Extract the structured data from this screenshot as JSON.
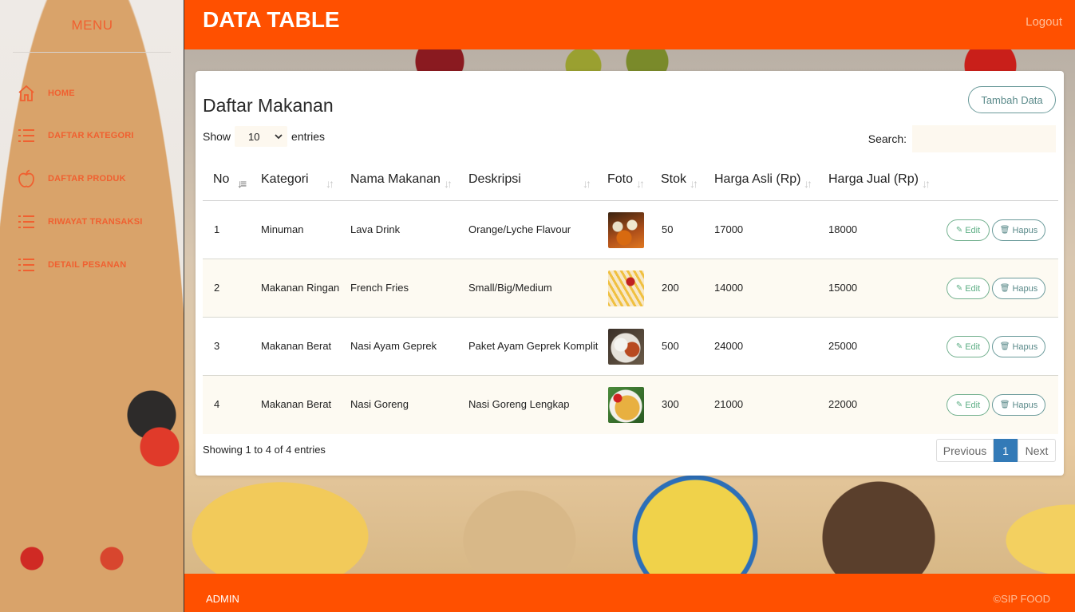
{
  "sidebar": {
    "title": "MENU",
    "items": [
      {
        "label": "HOME",
        "icon": "home-icon"
      },
      {
        "label": "DAFTAR KATEGORI",
        "icon": "list-icon"
      },
      {
        "label": "DAFTAR PRODUK",
        "icon": "apple-icon"
      },
      {
        "label": "RIWAYAT TRANSAKSI",
        "icon": "list-icon"
      },
      {
        "label": "DETAIL PESANAN",
        "icon": "list-icon"
      }
    ]
  },
  "header": {
    "title": "DATA TABLE",
    "logout": "Logout"
  },
  "card": {
    "title": "Daftar Makanan",
    "add_button": "Tambah Data",
    "show_label": "Show",
    "show_value": "10",
    "entries_label": "entries",
    "search_label": "Search:",
    "search_value": ""
  },
  "table": {
    "columns": [
      "No",
      "Kategori",
      "Nama Makanan",
      "Deskripsi",
      "Foto",
      "Stok",
      "Harga Asli (Rp)",
      "Harga Jual (Rp)"
    ],
    "rows": [
      {
        "no": "1",
        "kategori": "Minuman",
        "nama": "Lava Drink",
        "deskripsi": "Orange/Lyche Flavour",
        "stok": "50",
        "harga_asli": "17000",
        "harga_jual": "18000"
      },
      {
        "no": "2",
        "kategori": "Makanan Ringan",
        "nama": "French Fries",
        "deskripsi": "Small/Big/Medium",
        "stok": "200",
        "harga_asli": "14000",
        "harga_jual": "15000"
      },
      {
        "no": "3",
        "kategori": "Makanan Berat",
        "nama": "Nasi Ayam Geprek",
        "deskripsi": "Paket Ayam Geprek Komplit",
        "stok": "500",
        "harga_asli": "24000",
        "harga_jual": "25000"
      },
      {
        "no": "4",
        "kategori": "Makanan Berat",
        "nama": "Nasi Goreng",
        "deskripsi": "Nasi Goreng Lengkap",
        "stok": "300",
        "harga_asli": "21000",
        "harga_jual": "22000"
      }
    ],
    "edit_label": "Edit",
    "delete_label": "Hapus"
  },
  "footer_table": {
    "info": "Showing 1 to 4 of 4 entries",
    "previous": "Previous",
    "current_page": "1",
    "next": "Next"
  },
  "footer": {
    "left": "ADMIN",
    "right": "©SIP FOOD"
  },
  "colors": {
    "brand": "#ff5000",
    "accent": "#f06030",
    "page_active": "#337ab7",
    "edit": "#5cae84"
  }
}
